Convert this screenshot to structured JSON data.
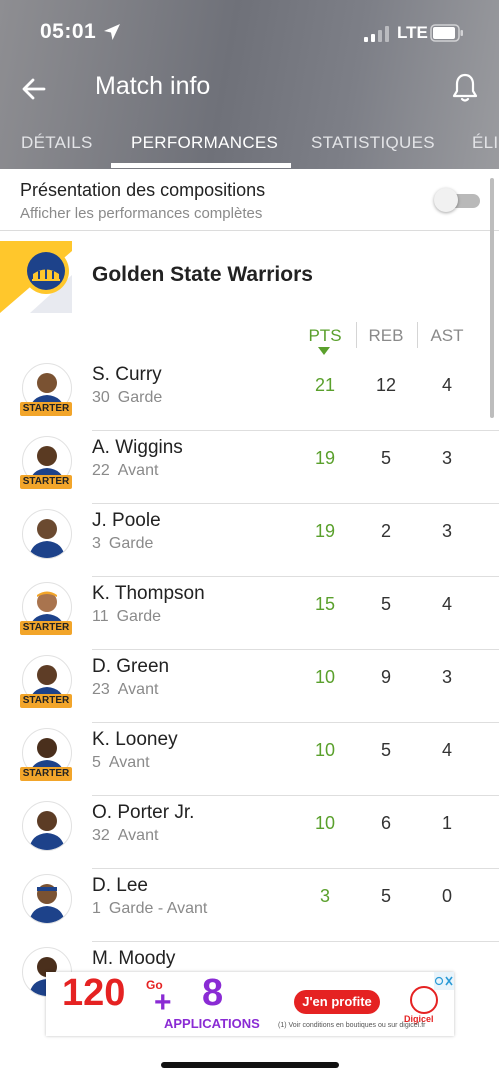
{
  "status_bar": {
    "time": "05:01",
    "network": "LTE"
  },
  "header": {
    "title": "Match info"
  },
  "tabs": [
    {
      "label": "DÉTAILS",
      "active": false
    },
    {
      "label": "PERFORMANCES",
      "active": true
    },
    {
      "label": "STATISTIQUES",
      "active": false
    },
    {
      "label": "ÉLI",
      "active": false
    }
  ],
  "lineup_toggle": {
    "title": "Présentation des compositions",
    "subtitle": "Afficher les performances complètes",
    "enabled": false
  },
  "team": {
    "name": "Golden State Warriors"
  },
  "stat_headers": {
    "pts": "PTS",
    "reb": "REB",
    "ast": "AST",
    "sorted_by": "PTS"
  },
  "starter_label": "STARTER",
  "players": [
    {
      "name": "S. Curry",
      "number": "30",
      "position": "Garde",
      "starter": true,
      "pts": "21",
      "reb": "12",
      "ast": "4"
    },
    {
      "name": "A. Wiggins",
      "number": "22",
      "position": "Avant",
      "starter": true,
      "pts": "19",
      "reb": "5",
      "ast": "3"
    },
    {
      "name": "J. Poole",
      "number": "3",
      "position": "Garde",
      "starter": false,
      "pts": "19",
      "reb": "2",
      "ast": "3"
    },
    {
      "name": "K. Thompson",
      "number": "11",
      "position": "Garde",
      "starter": true,
      "pts": "15",
      "reb": "5",
      "ast": "4"
    },
    {
      "name": "D. Green",
      "number": "23",
      "position": "Avant",
      "starter": true,
      "pts": "10",
      "reb": "9",
      "ast": "3"
    },
    {
      "name": "K. Looney",
      "number": "5",
      "position": "Avant",
      "starter": true,
      "pts": "10",
      "reb": "5",
      "ast": "4"
    },
    {
      "name": "O. Porter Jr.",
      "number": "32",
      "position": "Avant",
      "starter": false,
      "pts": "10",
      "reb": "6",
      "ast": "1"
    },
    {
      "name": "D. Lee",
      "number": "1",
      "position": "Garde - Avant",
      "starter": false,
      "pts": "3",
      "reb": "5",
      "ast": "0"
    },
    {
      "name": "M. Moody",
      "number": "",
      "position": "",
      "starter": false,
      "pts": "",
      "reb": "",
      "ast": ""
    }
  ],
  "ad": {
    "headline_1": "120",
    "headline_1_suffix": "Go",
    "plus": "+",
    "headline_2": "8",
    "subline": "APPLICATIONS",
    "cta": "J'en profite",
    "brand": "Digicel",
    "legal": "(1) Voir conditions en boutiques ou sur digicel.fr"
  },
  "colors": {
    "accent_green": "#5aa02c",
    "starter_badge": "#f2a52a",
    "warriors_blue": "#1d428a",
    "warriors_gold": "#ffc72c"
  }
}
